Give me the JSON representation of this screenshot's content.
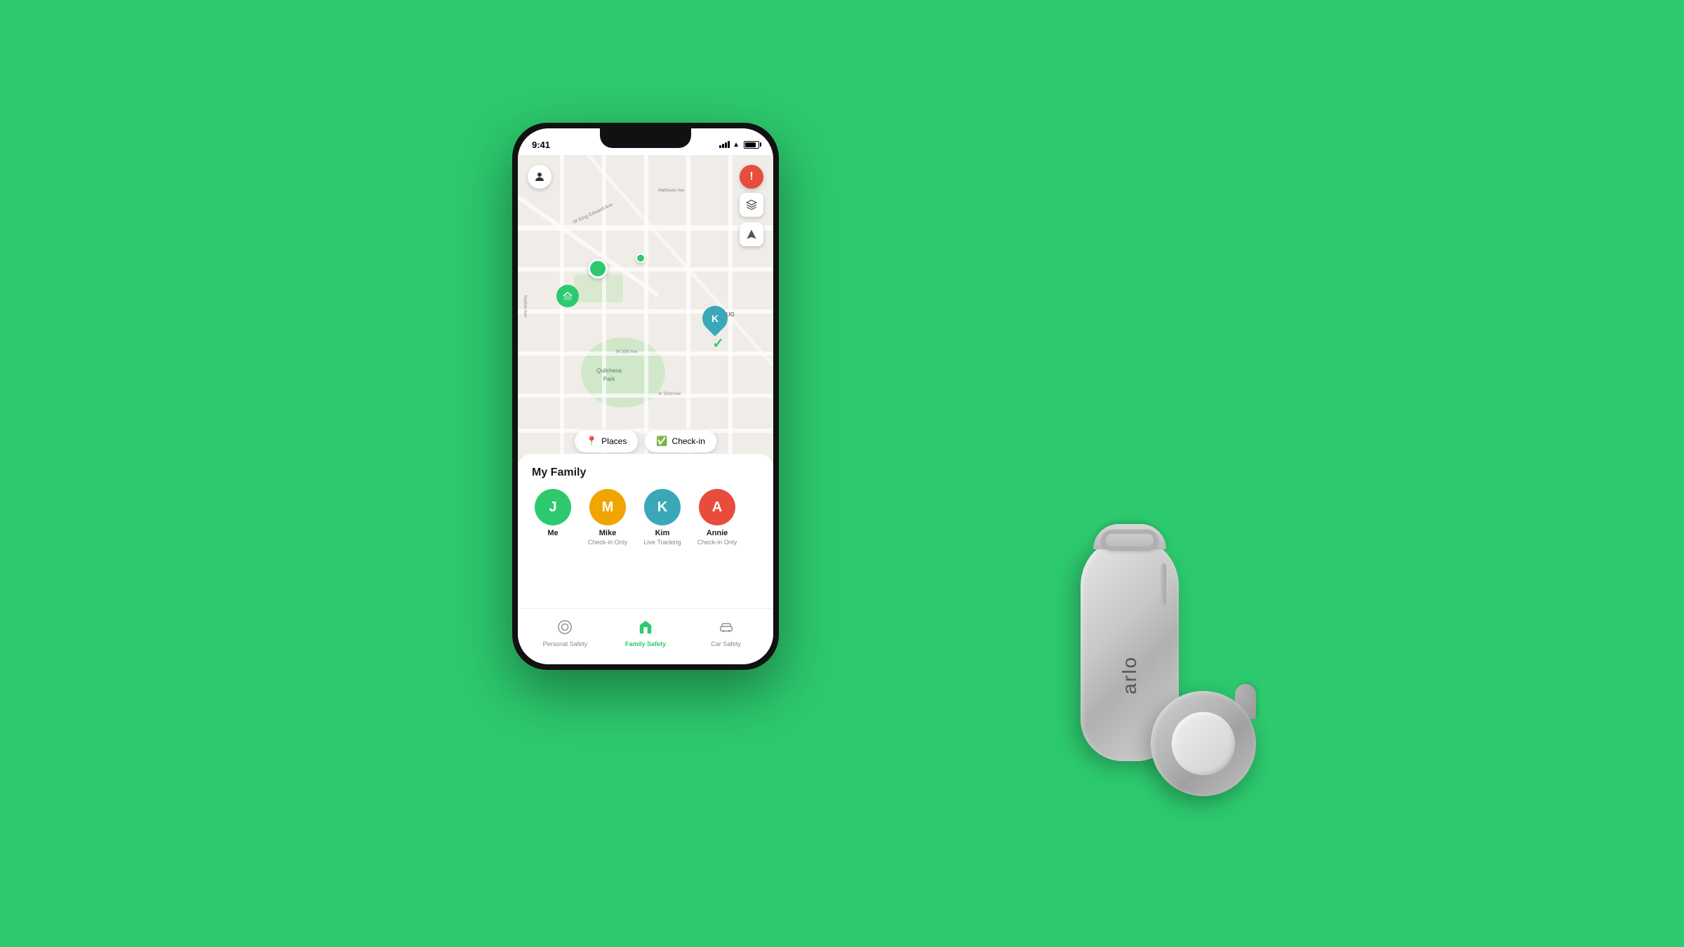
{
  "background": "#2DC96E",
  "phone": {
    "status": {
      "time": "9:41",
      "signal": "full",
      "wifi": true,
      "battery": "75%"
    },
    "map": {
      "pins": [
        {
          "label": "K",
          "color": "#3aa8b8"
        },
        {
          "label": "pin-house",
          "color": "#2DC96E"
        }
      ],
      "actions": [
        {
          "icon": "📍",
          "label": "Places"
        },
        {
          "icon": "✅",
          "label": "Check-in"
        }
      ],
      "map_buttons": {
        "alert": "!",
        "layers": "🗺",
        "location": "➤"
      }
    },
    "family": {
      "title": "My Family",
      "members": [
        {
          "initial": "J",
          "name": "Me",
          "status": "",
          "color": "#2DC96E"
        },
        {
          "initial": "M",
          "name": "Mike",
          "status": "Check-in Only",
          "color": "#f0a500"
        },
        {
          "initial": "K",
          "name": "Kim",
          "status": "Live Tracking",
          "color": "#3aa8b8"
        },
        {
          "initial": "A",
          "name": "Annie",
          "status": "Check-in Only",
          "color": "#e74c3c"
        }
      ]
    },
    "nav": {
      "items": [
        {
          "icon": "○",
          "label": "Personal Safety",
          "active": false
        },
        {
          "icon": "⌂",
          "label": "Family Safety",
          "active": true
        },
        {
          "icon": "🚗",
          "label": "Car Safety",
          "active": false
        }
      ]
    }
  },
  "device": {
    "brand": "arlo"
  },
  "colors": {
    "green": "#2DC96E",
    "teal": "#3aa8b8",
    "orange": "#f0a500",
    "red": "#e74c3c"
  }
}
